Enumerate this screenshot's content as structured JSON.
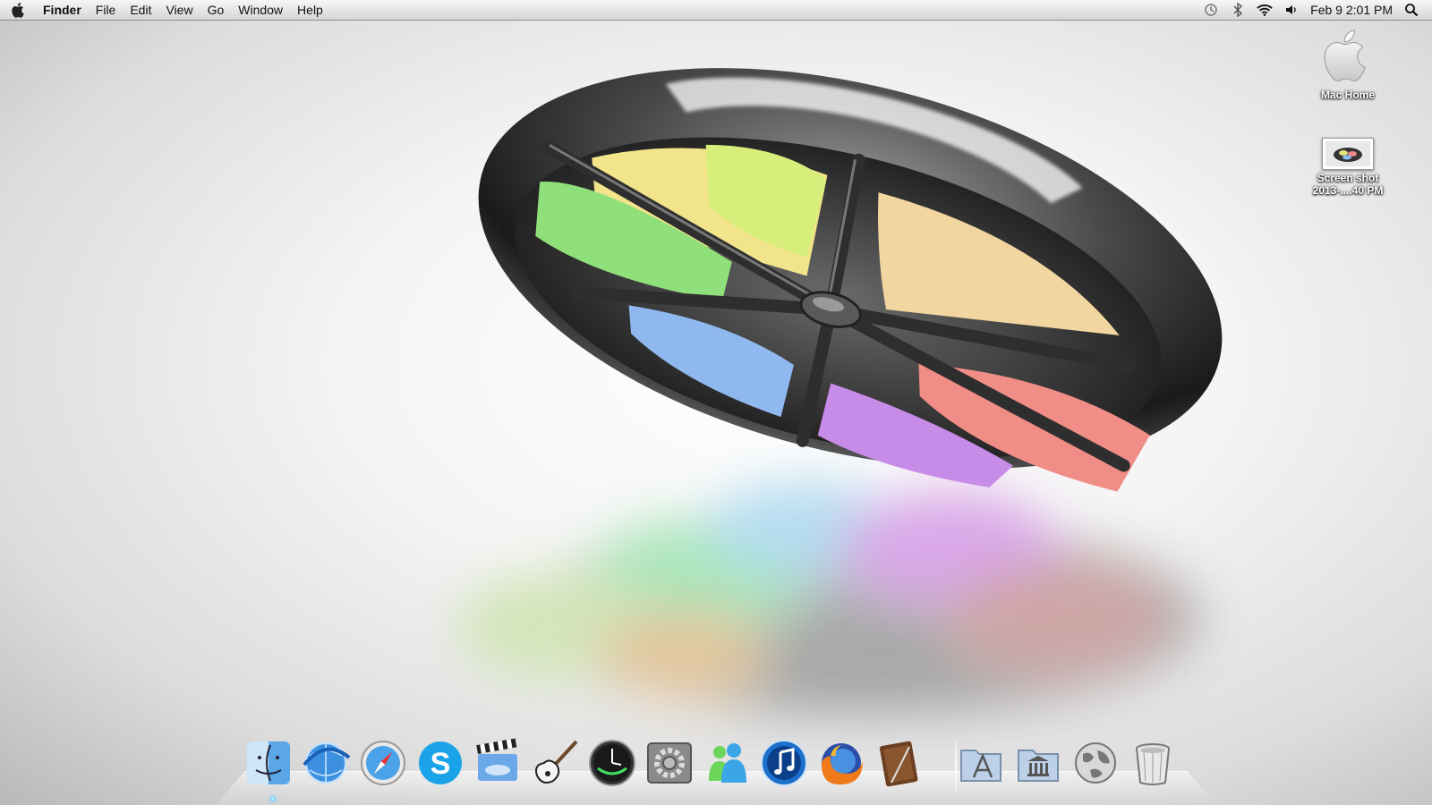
{
  "menubar": {
    "app_name": "Finder",
    "items": [
      "File",
      "Edit",
      "View",
      "Go",
      "Window",
      "Help"
    ],
    "status_icons": [
      "time-machine-icon",
      "bluetooth-icon",
      "wifi-icon",
      "volume-icon"
    ],
    "clock": "Feb 9  2:01 PM",
    "spotlight_icon": "spotlight-icon"
  },
  "desktop": {
    "icons": [
      {
        "label": "Mac Home",
        "icon": "apple-logo-icon"
      },
      {
        "label": "Screen shot\n2013-...40 PM",
        "label_line1": "Screen shot",
        "label_line2": "2013-....40 PM",
        "icon": "screenshot-file-icon"
      }
    ]
  },
  "dock": {
    "apps": [
      {
        "icon": "finder-icon"
      },
      {
        "icon": "ie-globe-icon"
      },
      {
        "icon": "safari-icon"
      },
      {
        "icon": "skype-icon"
      },
      {
        "icon": "imovie-icon"
      },
      {
        "icon": "garageband-icon"
      },
      {
        "icon": "clock-icon"
      },
      {
        "icon": "system-preferences-icon"
      },
      {
        "icon": "messenger-icon"
      },
      {
        "icon": "itunes-icon"
      },
      {
        "icon": "firefox-icon"
      },
      {
        "icon": "notebook-icon"
      }
    ],
    "stacks": [
      {
        "icon": "applications-folder-icon"
      },
      {
        "icon": "library-folder-icon"
      },
      {
        "icon": "network-globe-icon"
      },
      {
        "icon": "trash-icon"
      }
    ]
  },
  "colors": {
    "wheel_yellow": "#f2e48a",
    "wheel_lime": "#d8ee7a",
    "wheel_green": "#8fe07a",
    "wheel_blue": "#8fb8ee",
    "wheel_purple": "#c78be8",
    "wheel_red": "#f08d86",
    "wheel_peach": "#f2d6a0"
  }
}
